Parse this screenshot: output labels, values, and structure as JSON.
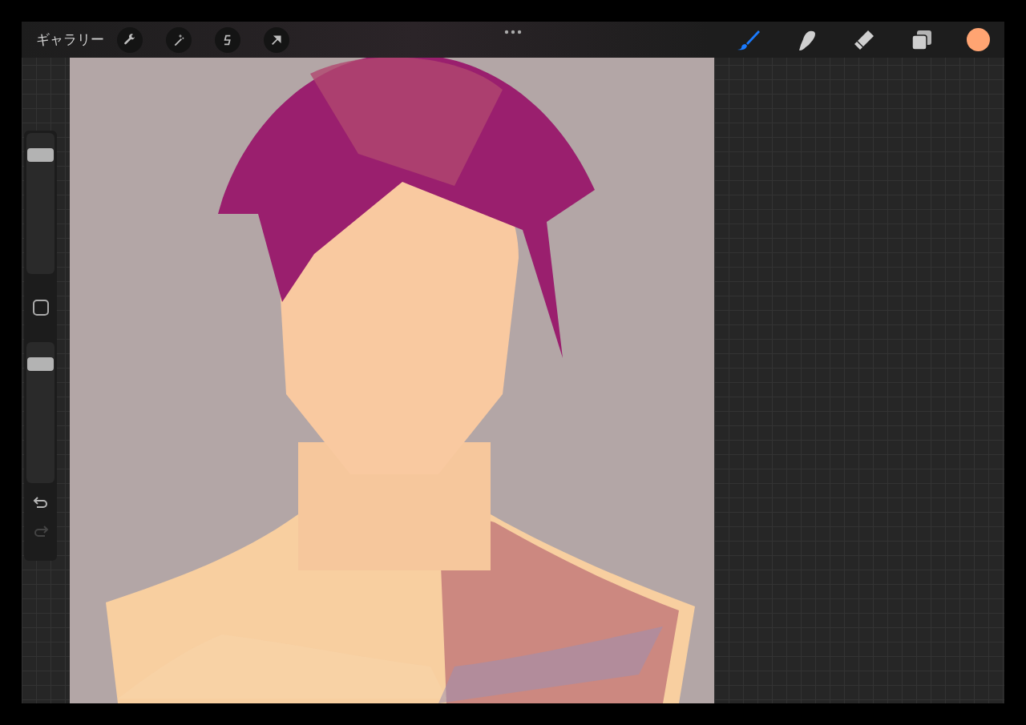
{
  "top_bar": {
    "gallery": "ギャラリー",
    "left_tools": [
      {
        "kind": "wrench"
      },
      {
        "kind": "wand"
      },
      {
        "kind": "selection"
      },
      {
        "kind": "arrow"
      }
    ],
    "right_tools": [
      {
        "kind": "brush",
        "selected": true
      },
      {
        "kind": "smudge",
        "selected": false
      },
      {
        "kind": "eraser",
        "selected": false
      },
      {
        "kind": "layers",
        "selected": false
      }
    ],
    "color": "#ffa472"
  },
  "sidebar": {
    "size_slider": {
      "level": 0.88
    },
    "opacity_slider": {
      "level": 0.88
    },
    "undo": {
      "disabled": false
    },
    "redo": {
      "disabled": true
    }
  }
}
